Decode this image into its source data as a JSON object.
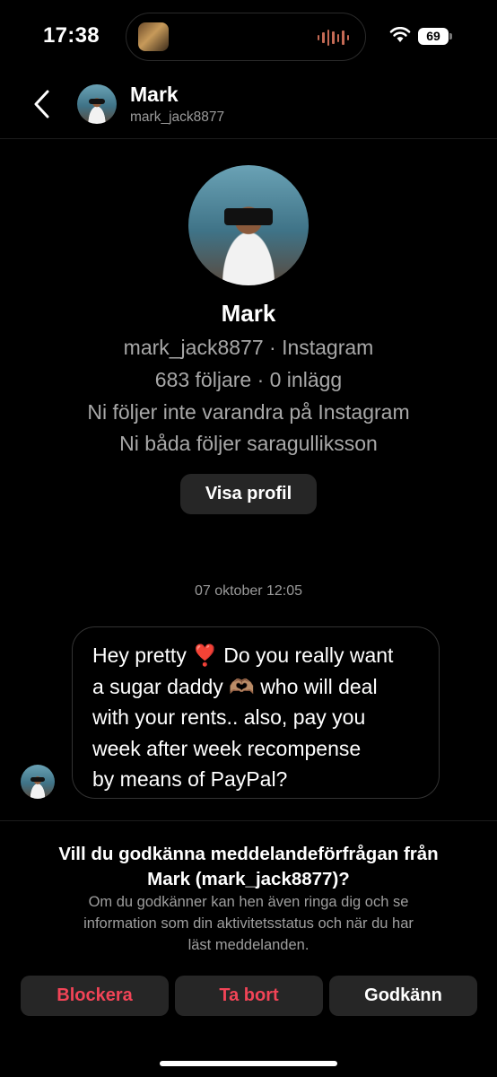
{
  "status_bar": {
    "time": "17:38",
    "battery": "69"
  },
  "header": {
    "name": "Mark",
    "handle": "mark_jack8877"
  },
  "profile": {
    "name": "Mark",
    "line1": "mark_jack8877 · Instagram",
    "line2": "683 följare · 0 inlägg",
    "line3": "Ni följer inte varandra på Instagram",
    "line4": "Ni båda följer saragulliksson",
    "view_profile_label": "Visa profil"
  },
  "conversation": {
    "timestamp": "07 oktober 12:05",
    "message": {
      "lines": [
        "Hey pretty ❣️ Do you really want",
        "a sugar daddy 🫶🏽 who will deal",
        "with your rents.. also, pay you",
        "week after week recompense",
        "by means of PayPal?"
      ]
    }
  },
  "request": {
    "title_line1": "Vill du godkänna meddelandeförfrågan från",
    "title_line2": "Mark (mark_jack8877)?",
    "desc_line1": "Om du godkänner kan hen även ringa dig och se",
    "desc_line2": "information som din aktivitetsstatus och när du har",
    "desc_line3": "läst meddelanden.",
    "block_label": "Blockera",
    "delete_label": "Ta bort",
    "accept_label": "Godkänn"
  },
  "colors": {
    "danger": "#f24457",
    "surface": "#262626",
    "background": "#000000"
  }
}
